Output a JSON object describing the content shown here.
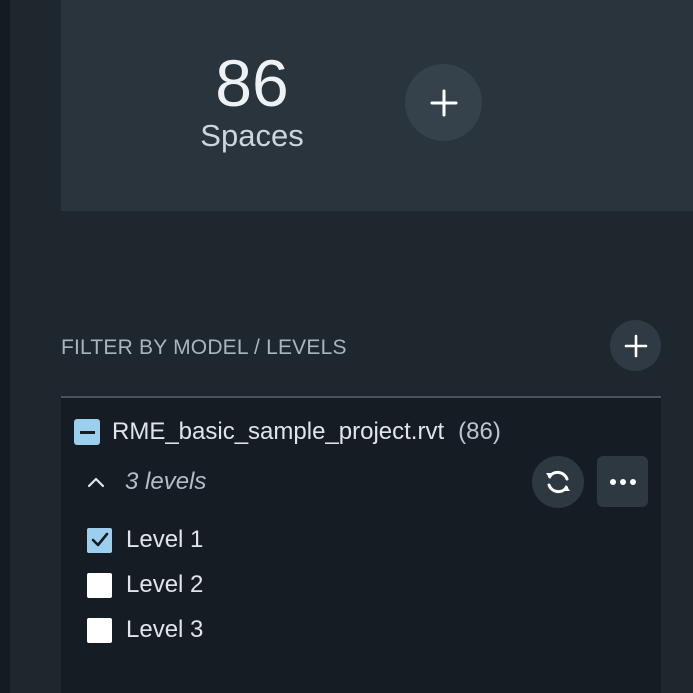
{
  "summary": {
    "count": "86",
    "label": "Spaces"
  },
  "filter": {
    "title": "FILTER BY MODEL / LEVELS"
  },
  "model": {
    "name": "RME_basic_sample_project.rvt",
    "count": "(86)",
    "levels_summary": "3 levels",
    "levels": [
      {
        "label": "Level 1",
        "checked": true
      },
      {
        "label": "Level 2",
        "checked": false
      },
      {
        "label": "Level 3",
        "checked": false
      }
    ]
  },
  "colors": {
    "accent": "#9ccfee",
    "background": "#1e272e",
    "card": "#2a343d",
    "panel": "#151c23"
  },
  "icons": {
    "add_space": "plus-icon",
    "add_filter": "plus-icon",
    "model_toggle": "minus-icon",
    "collapse": "chevron-up-icon",
    "sync": "sync-icon",
    "more": "more-horizontal-icon",
    "check": "check-icon"
  }
}
